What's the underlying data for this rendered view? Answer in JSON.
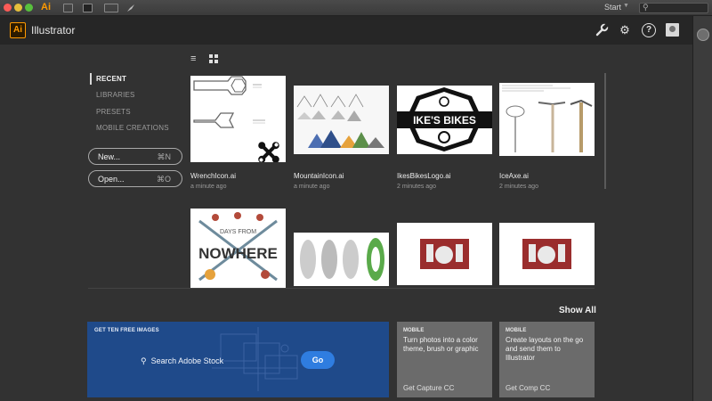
{
  "menubar": {
    "app_mark": "Ai",
    "workspace": "Start",
    "search_placeholder": ""
  },
  "header": {
    "logo_text": "Ai",
    "app_title": "Illustrator",
    "icons": [
      "wrench-icon",
      "gear-icon",
      "help-icon",
      "user-icon"
    ],
    "help_glyph": "?"
  },
  "sidebar": {
    "items": [
      {
        "label": "RECENT",
        "active": true
      },
      {
        "label": "LIBRARIES",
        "active": false
      },
      {
        "label": "PRESETS",
        "active": false
      },
      {
        "label": "MOBILE CREATIONS",
        "active": false
      }
    ],
    "new_button": {
      "label": "New...",
      "shortcut": "⌘N"
    },
    "open_button": {
      "label": "Open...",
      "shortcut": "⌘O"
    }
  },
  "recent_files": [
    {
      "name": "WrenchIcon.ai",
      "time": "a minute ago"
    },
    {
      "name": "MountainIcon.ai",
      "time": "a minute ago"
    },
    {
      "name": "IkesBikesLogo.ai",
      "time": "2 minutes ago"
    },
    {
      "name": "IceAxe.ai",
      "time": "2 minutes ago"
    }
  ],
  "thumbnail_text": {
    "ikes_bikes": "IKE'S BIKES",
    "days_from": "DAYS FROM",
    "nowhere": "NOWHERE"
  },
  "show_all": "Show All",
  "stock": {
    "title": "GET TEN FREE IMAGES",
    "search_label": "Search Adobe Stock",
    "go_label": "Go"
  },
  "promos": [
    {
      "kicker": "MOBILE",
      "body": "Turn photos into a color theme, brush or graphic",
      "cta": "Get Capture CC"
    },
    {
      "kicker": "MOBILE",
      "body": "Create layouts on the go and send them to Illustrator",
      "cta": "Get Comp CC"
    }
  ],
  "colors": {
    "accent": "#ff9a00",
    "background": "#323232",
    "stock_blue": "#1f4a8a",
    "go_button": "#2f7de0"
  }
}
